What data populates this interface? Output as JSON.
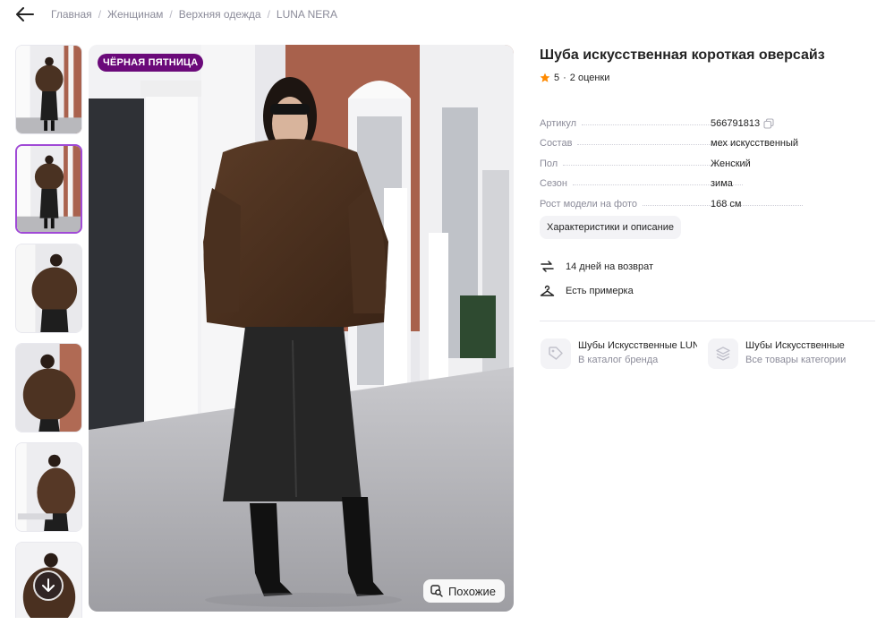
{
  "breadcrumb": [
    "Главная",
    "Женщинам",
    "Верхняя одежда",
    "LUNA NERA"
  ],
  "promo_badge": "ЧЁРНАЯ ПЯТНИЦА",
  "similar_button": "Похожие",
  "product": {
    "title": "Шуба искусственная короткая оверсайз",
    "rating": "5",
    "reviews": "2 оценки"
  },
  "specs": [
    {
      "key": "Артикул",
      "value": "566791813"
    },
    {
      "key": "Состав",
      "value": "мех искусственный"
    },
    {
      "key": "Пол",
      "value": "Женский"
    },
    {
      "key": "Сезон",
      "value": "зима"
    },
    {
      "key": "Рост модели на фото",
      "value": "168 см"
    }
  ],
  "characteristics_button": "Характеристики и описание",
  "features": {
    "returns": "14 дней на возврат",
    "fitting": "Есть примерка"
  },
  "links": {
    "brand": {
      "title": "Шубы Искусственные LUNA NERA",
      "subtitle": "В каталог бренда"
    },
    "category": {
      "title": "Шубы Искусственные",
      "subtitle": "Все товары категории"
    }
  },
  "colors": {
    "accent": "#a04ad6",
    "badge": "#6b0a7a",
    "star": "#ff8a00"
  }
}
